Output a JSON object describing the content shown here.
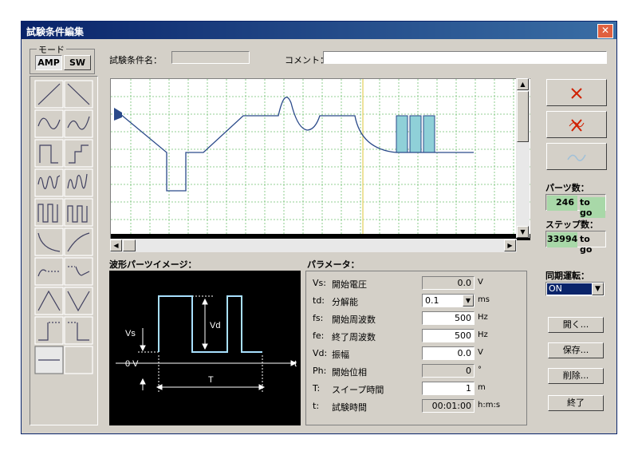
{
  "window": {
    "title": "試験条件編集",
    "close_glyph": "✕"
  },
  "mode": {
    "legend": "モード",
    "amp_label": "AMP",
    "sw_label": "SW",
    "selected": "AMP"
  },
  "header": {
    "name_label": "試験条件名：",
    "name_value": "",
    "comment_label": "コメント：",
    "comment_value": ""
  },
  "waveform_palette": [
    "ramp-up-icon",
    "ramp-down-icon",
    "sine-half-icon",
    "sine-half-inverted-icon",
    "pulse-up-icon",
    "pulse-down-icon",
    "sine-burst-icon",
    "sine-burst-inverted-icon",
    "square-burst-icon",
    "square-burst-inverted-icon",
    "decay-curve-icon",
    "rise-curve-icon",
    "step-dotted-icon",
    "dip-dotted-icon",
    "triangle-up-icon",
    "triangle-down-icon",
    "step-up-dotted-icon",
    "step-down-dotted-icon",
    "flat-line-icon",
    "blank-icon"
  ],
  "image_panel": {
    "label": "波形パーツイメージ：",
    "vs": "Vs",
    "vd": "Vd",
    "zero": "0 V",
    "t_axis": "t",
    "period": "T"
  },
  "params": {
    "label": "パラメータ：",
    "rows": [
      {
        "key": "Vs:",
        "name": "開始電圧",
        "value": "0.0",
        "unit": "V",
        "editable": false
      },
      {
        "key": "td:",
        "name": "分解能",
        "value": "0.1",
        "unit": "ms",
        "editable": true,
        "dropdown": true
      },
      {
        "key": "fs:",
        "name": "開始周波数",
        "value": "500",
        "unit": "Hz",
        "editable": true
      },
      {
        "key": "fe:",
        "name": "終了周波数",
        "value": "500",
        "unit": "Hz",
        "editable": true
      },
      {
        "key": "Vd:",
        "name": "振幅",
        "value": "0.0",
        "unit": "V",
        "editable": true
      },
      {
        "key": "Ph:",
        "name": "開始位相",
        "value": "0",
        "unit": "°",
        "editable": false
      },
      {
        "key": "T:",
        "name": "スイープ時間",
        "value": "1",
        "unit": "m",
        "editable": true
      },
      {
        "key": "t:",
        "name": "試験時間",
        "value": "00:01:00",
        "unit": "h:m:s",
        "editable": false
      }
    ]
  },
  "right_panel": {
    "parts_label": "パーツ数：",
    "parts_value": "246",
    "parts_suffix": "to go",
    "steps_label": "ステップ数：",
    "steps_value": "33994",
    "steps_suffix": "to go",
    "sync_label": "同期運転：",
    "sync_value": "ON",
    "open_btn": "開く...",
    "save_btn": "保存...",
    "delete_btn": "削除...",
    "exit_btn": "終了"
  },
  "colors": {
    "accent_blue": "#0a246a",
    "count_green": "#a8d8a8",
    "burst_fill": "#8fd0d8",
    "waveform": "#2a4a8a"
  }
}
